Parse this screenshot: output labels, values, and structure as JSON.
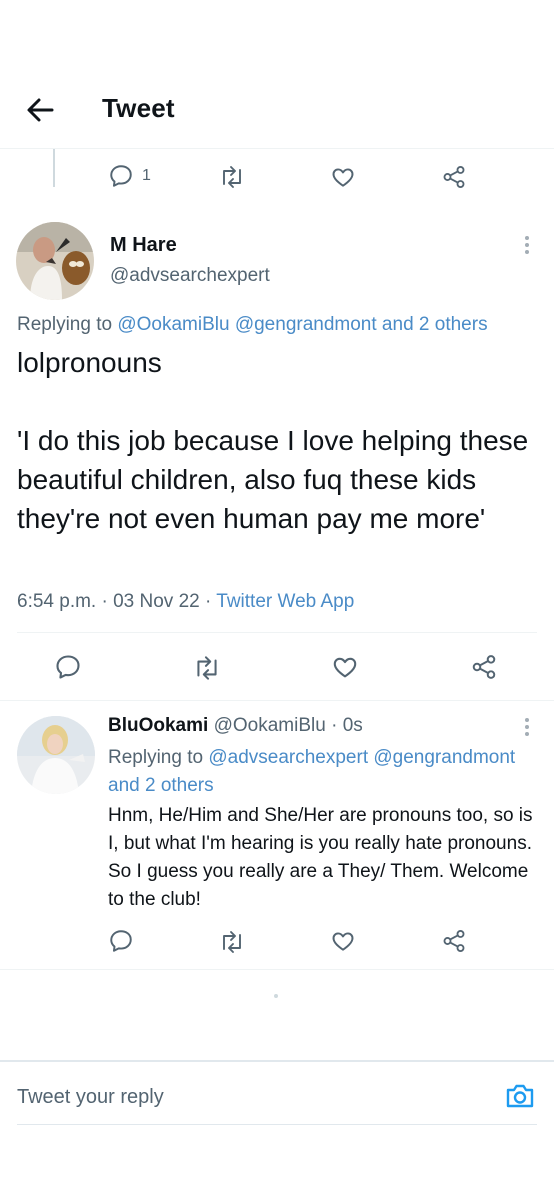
{
  "header": {
    "title": "Tweet"
  },
  "parent_actions": {
    "reply_count": "1"
  },
  "main_tweet": {
    "name": "M Hare",
    "handle": "@advsearchexpert",
    "replying_prefix": "Replying to",
    "replying_to": "@OokamiBlu @gengrandmont and 2 others",
    "text": "lolpronouns\n\n'I do this job because I love helping these beautiful children, also fuq these kids they're not even human pay me more'",
    "time": "6:54 p.m.",
    "date": "03 Nov 22",
    "source": "Twitter Web App",
    "sep": "·"
  },
  "reply_tweet": {
    "name": "BluOokami",
    "handle": "@OokamiBlu",
    "time": "0s",
    "sep": "·",
    "replying_prefix": "Replying to",
    "replying_to": "@advsearchexpert @gengrandmont and 2 others",
    "text": "Hnm, He/Him and She/Her are pronouns too, so is I, but what I'm hearing is you really hate pronouns. So I guess you really are a They/ Them. Welcome to the club!"
  },
  "composer": {
    "placeholder": "Tweet your reply"
  },
  "colors": {
    "link": "#4a8bc7",
    "text": "#0f1419",
    "muted": "#536471"
  },
  "icons": [
    "back-arrow-icon",
    "reply-icon",
    "retweet-icon",
    "like-icon",
    "share-icon",
    "more-icon",
    "camera-icon"
  ]
}
